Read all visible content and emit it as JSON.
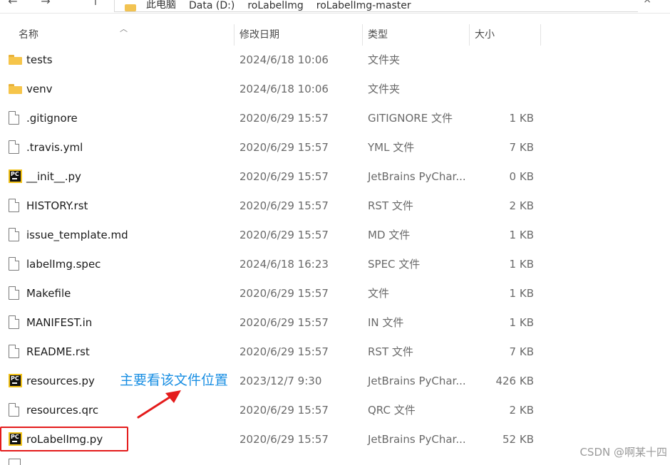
{
  "nav": {
    "back": "←",
    "forward": "→",
    "up": "↑"
  },
  "address": {
    "segments": [
      "此电脑",
      "Data (D:)",
      "roLabelImg",
      "roLabelImg-master"
    ],
    "close": "×"
  },
  "columns": {
    "name": "名称",
    "date": "修改日期",
    "type": "类型",
    "size": "大小"
  },
  "files": [
    {
      "icon": "folder-icon",
      "name": "tests",
      "date": "2024/6/18 10:06",
      "type": "文件夹",
      "size": ""
    },
    {
      "icon": "folder-icon",
      "name": "venv",
      "date": "2024/6/18 10:06",
      "type": "文件夹",
      "size": ""
    },
    {
      "icon": "file-icon",
      "name": ".gitignore",
      "date": "2020/6/29 15:57",
      "type": "GITIGNORE 文件",
      "size": "1 KB"
    },
    {
      "icon": "file-icon",
      "name": ".travis.yml",
      "date": "2020/6/29 15:57",
      "type": "YML 文件",
      "size": "7 KB"
    },
    {
      "icon": "pycharm-icon",
      "name": "__init__.py",
      "date": "2020/6/29 15:57",
      "type": "JetBrains PyChar...",
      "size": "0 KB"
    },
    {
      "icon": "file-icon",
      "name": "HISTORY.rst",
      "date": "2020/6/29 15:57",
      "type": "RST 文件",
      "size": "2 KB"
    },
    {
      "icon": "file-icon",
      "name": "issue_template.md",
      "date": "2020/6/29 15:57",
      "type": "MD 文件",
      "size": "1 KB"
    },
    {
      "icon": "file-icon",
      "name": "labelImg.spec",
      "date": "2024/6/18 16:23",
      "type": "SPEC 文件",
      "size": "1 KB"
    },
    {
      "icon": "file-icon",
      "name": "Makefile",
      "date": "2020/6/29 15:57",
      "type": "文件",
      "size": "1 KB"
    },
    {
      "icon": "file-icon",
      "name": "MANIFEST.in",
      "date": "2020/6/29 15:57",
      "type": "IN 文件",
      "size": "1 KB"
    },
    {
      "icon": "file-icon",
      "name": "README.rst",
      "date": "2020/6/29 15:57",
      "type": "RST 文件",
      "size": "7 KB"
    },
    {
      "icon": "pycharm-icon",
      "name": "resources.py",
      "date": "2023/12/7 9:30",
      "type": "JetBrains PyChar...",
      "size": "426 KB"
    },
    {
      "icon": "file-icon",
      "name": "resources.qrc",
      "date": "2020/6/29 15:57",
      "type": "QRC 文件",
      "size": "2 KB"
    },
    {
      "icon": "pycharm-icon",
      "name": "roLabelImg.py",
      "date": "2020/6/29 15:57",
      "type": "JetBrains PyChar...",
      "size": "52 KB"
    }
  ],
  "annotation": {
    "text": "主要看该文件位置",
    "text_color": "#1a8fe3",
    "arrow_color": "#e41b1b",
    "highlight_color": "#e41b1b"
  },
  "watermark": "CSDN @啊某十四"
}
